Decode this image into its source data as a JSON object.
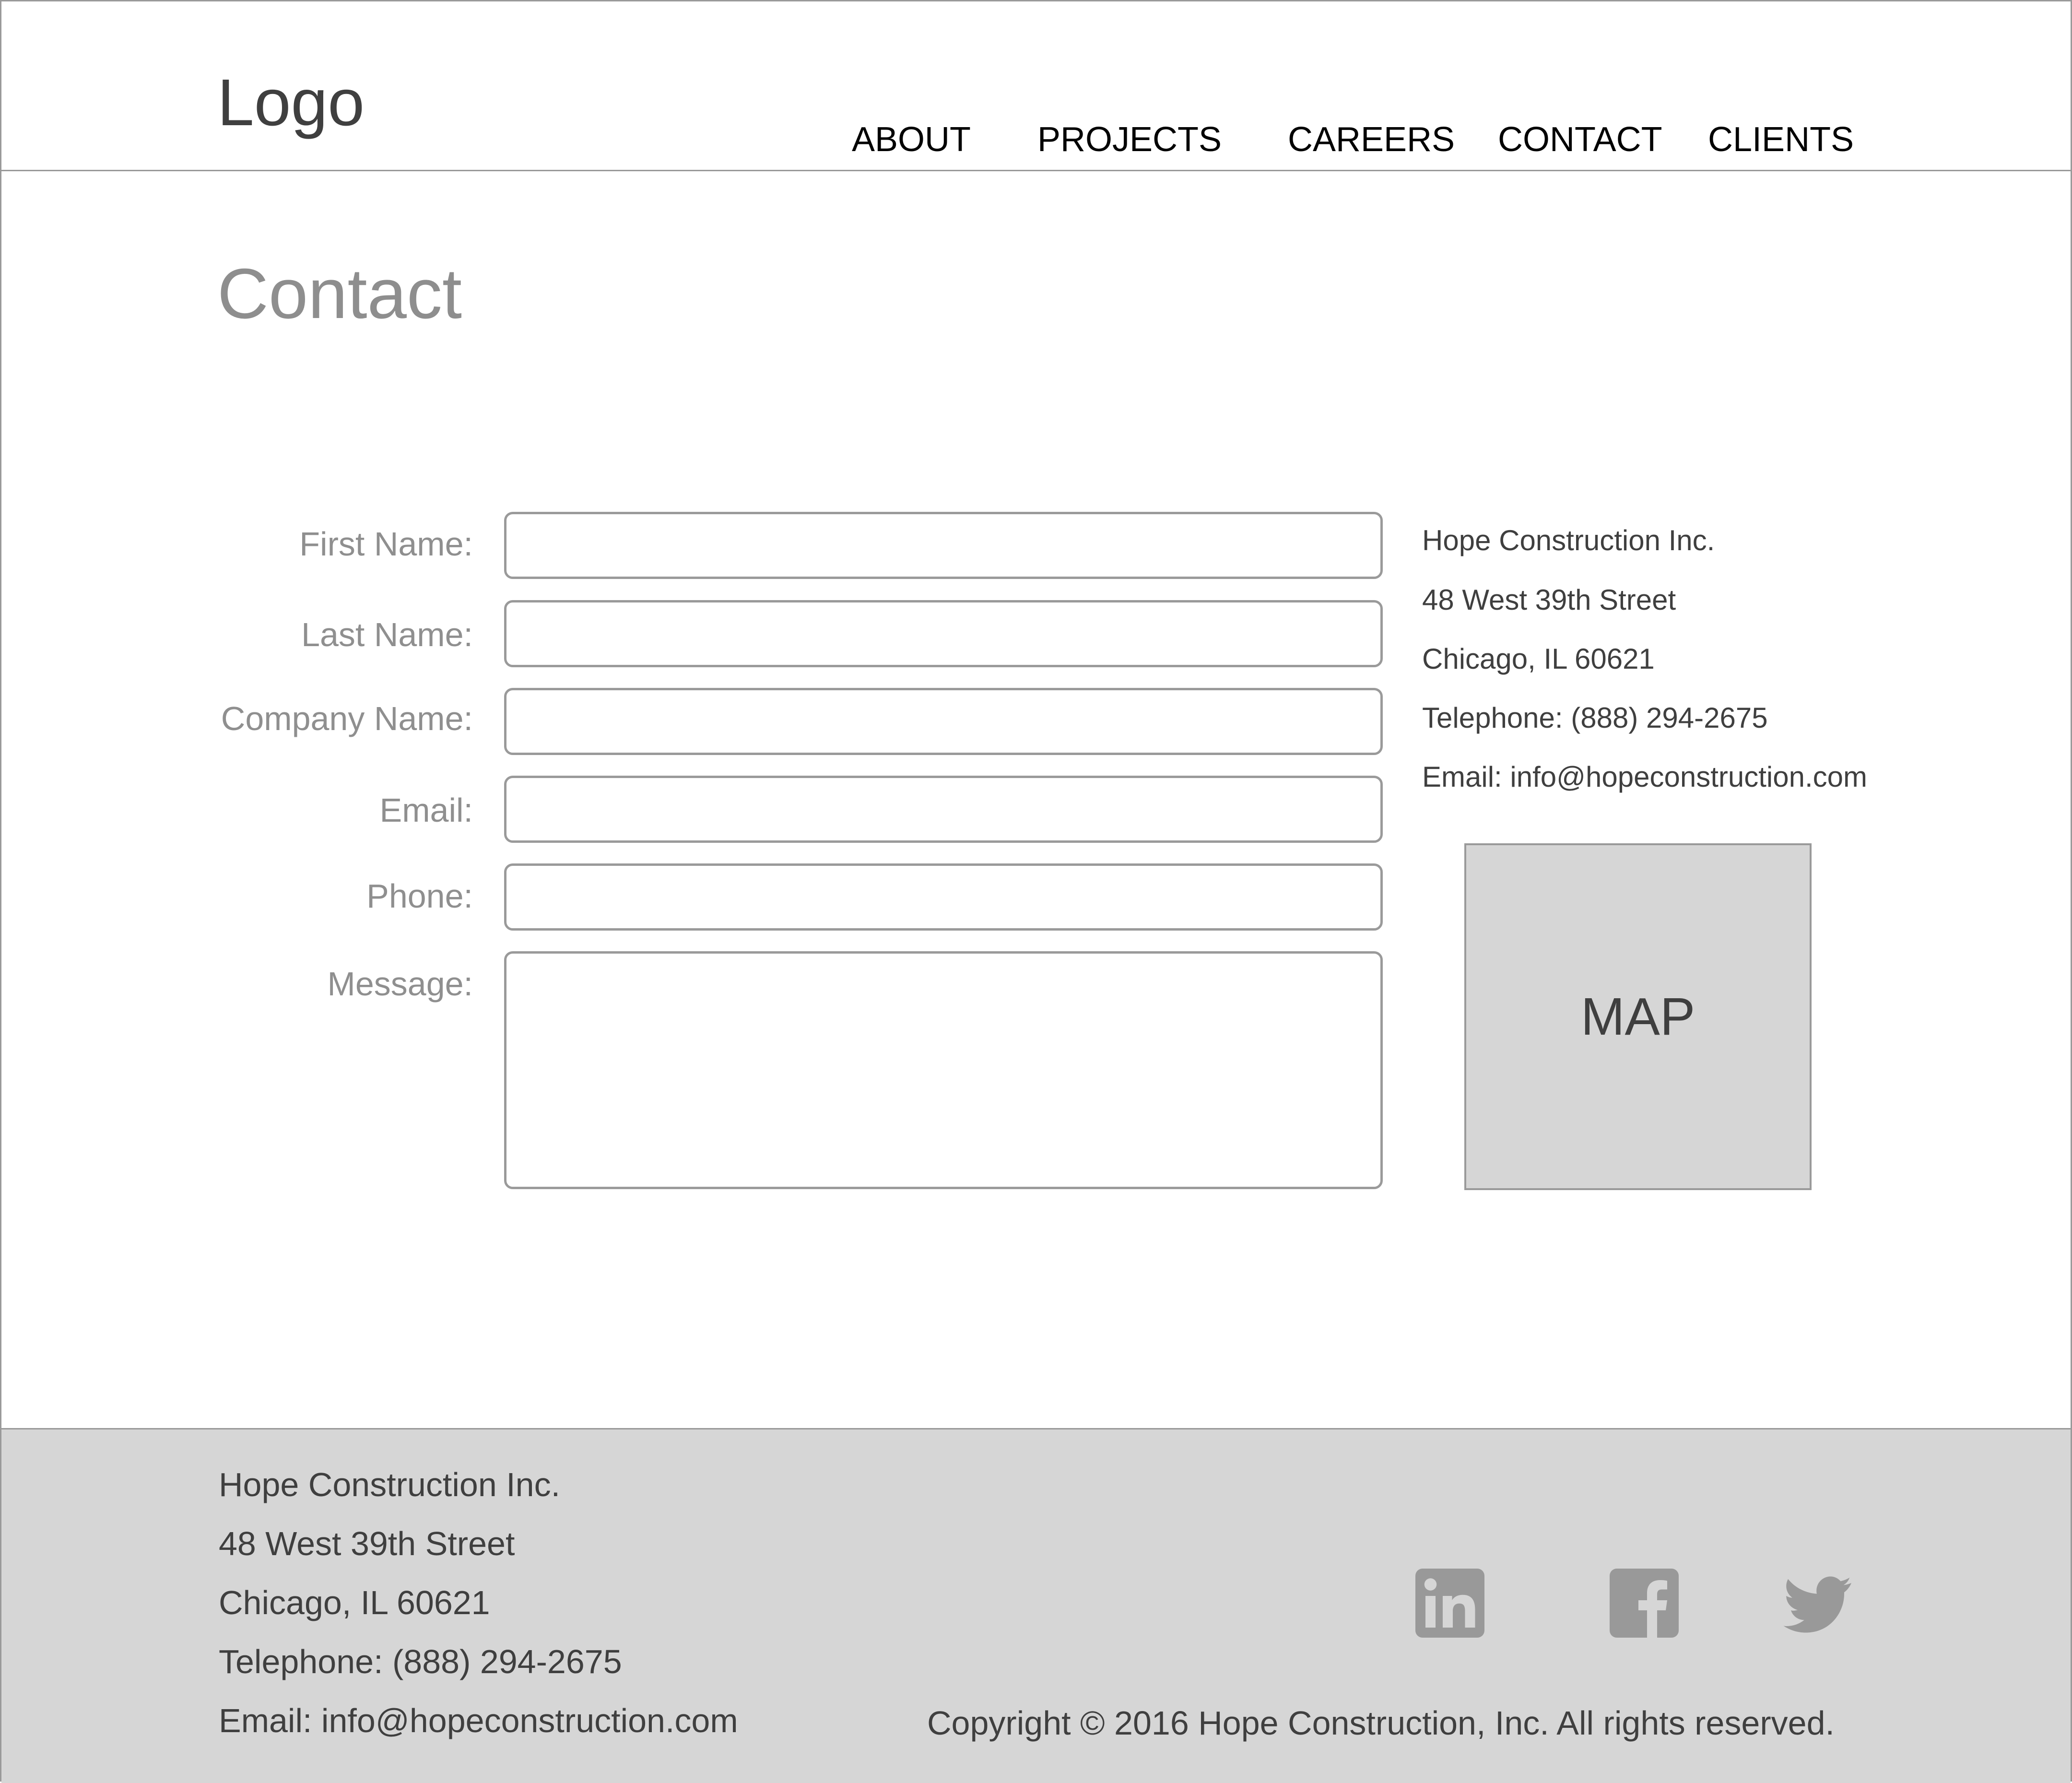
{
  "header": {
    "logo": "Logo",
    "nav": [
      "ABOUT",
      "PROJECTS",
      "CAREERS",
      "CONTACT",
      "CLIENTS"
    ]
  },
  "page_title": "Contact",
  "form": {
    "fields": [
      {
        "label": "First Name:",
        "value": ""
      },
      {
        "label": "Last Name:",
        "value": ""
      },
      {
        "label": "Company Name:",
        "value": ""
      },
      {
        "label": "Email:",
        "value": ""
      },
      {
        "label": "Phone:",
        "value": ""
      }
    ],
    "message": {
      "label": "Message:",
      "value": ""
    }
  },
  "contact_info": {
    "company": "Hope Construction Inc.",
    "street": "48 West 39th Street",
    "city": "Chicago, IL 60621",
    "telephone": "Telephone: (888) 294-2675",
    "email": "Email: info@hopeconstruction.com"
  },
  "map": {
    "label": "MAP"
  },
  "footer": {
    "company": "Hope Construction Inc.",
    "street": "48 West 39th Street",
    "city": "Chicago, IL 60621",
    "telephone": "Telephone: (888) 294-2675",
    "email": "Email: info@hopeconstruction.com",
    "copyright": "Copyright © 2016 Hope Construction, Inc. All rights reserved.",
    "social_icons": [
      "linkedin-icon",
      "facebook-icon",
      "twitter-icon"
    ]
  },
  "colors": {
    "border": "#9a9a9a",
    "label_gray": "#8f8f8f",
    "text_dark": "#3f3f3f",
    "footer_bg": "#d6d6d6",
    "icon_gray": "#999999"
  }
}
